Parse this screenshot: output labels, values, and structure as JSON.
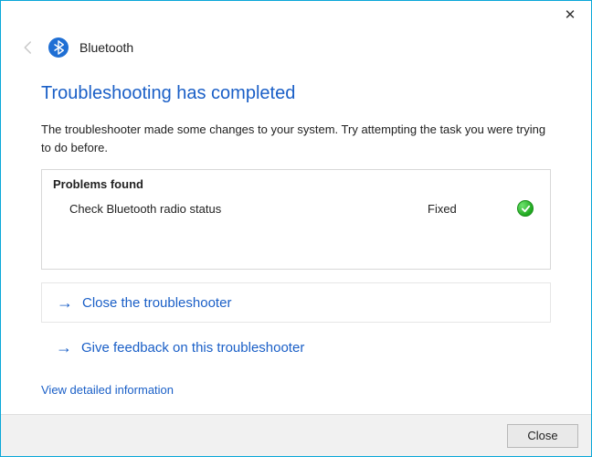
{
  "window": {
    "close_glyph": "✕"
  },
  "header": {
    "title": "Bluetooth"
  },
  "main": {
    "step_title": "Troubleshooting has completed",
    "description": "The troubleshooter made some changes to your system. Try attempting the task you were trying to do before.",
    "problems_header": "Problems found",
    "problems": [
      {
        "name": "Check Bluetooth radio status",
        "status": "Fixed"
      }
    ],
    "actions": {
      "close_troubleshooter": "Close the troubleshooter",
      "give_feedback": "Give feedback on this troubleshooter"
    },
    "detail_link": "View detailed information"
  },
  "footer": {
    "close_label": "Close"
  }
}
